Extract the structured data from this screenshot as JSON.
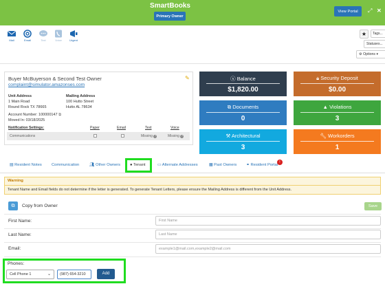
{
  "header": {
    "title": "SmartBooks",
    "primary_owner": "Primary Owner",
    "view_portal": "View Portal",
    "colors": {
      "bg": "#7cc244",
      "button": "#2a74b7"
    }
  },
  "toolbar": {
    "tools": [
      {
        "label": "Mail",
        "icon": "envelope-icon"
      },
      {
        "label": "Email",
        "icon": "at-sign-icon"
      },
      {
        "label": "Text",
        "icon": "chat-bubble-icon"
      },
      {
        "label": "Voice",
        "icon": "phone-icon"
      },
      {
        "label": "Urgent",
        "icon": "megaphone-icon"
      }
    ],
    "tags": "Tags...",
    "statuses": "Statuses...",
    "options": "Options"
  },
  "owner": {
    "name": "Buyer McBuyerson & Second Test Owner",
    "email": "complaint@simulator.amazonses.com",
    "unit_address_label": "Unit Address",
    "unit_address_line1": "1 Main Road",
    "unit_address_line2": "Round Rock TX 78665",
    "mailing_address_label": "Mailing Address",
    "mailing_address_line1": "100 Hutto Street",
    "mailing_address_line2": "Hutto AL 78634",
    "account_number": "Account Number: 100000147",
    "moved_in": "Moved In: 03/18/2025",
    "notification_settings": "Notification Settings:",
    "notif_headers": {
      "paper": "Paper",
      "email": "Email",
      "text": "Text",
      "voice": "Voice"
    },
    "notif_row": {
      "label": "Communications",
      "text": "Missing",
      "voice": "Missing"
    }
  },
  "tiles": [
    {
      "label": "Balance",
      "value": "$1,820.00",
      "color": "#2f3e4e",
      "icon": "dollar-icon"
    },
    {
      "label": "Security Deposit",
      "value": "$0.00",
      "color": "#c46c2c",
      "icon": "lock-icon"
    },
    {
      "label": "Documents",
      "value": "0",
      "color": "#2f7cc0",
      "icon": "copy-icon"
    },
    {
      "label": "Violations",
      "value": "3",
      "color": "#3ea63e",
      "icon": "warning-icon"
    },
    {
      "label": "Architectural",
      "value": "3",
      "color": "#12a9df",
      "icon": "hammer-icon"
    },
    {
      "label": "Workorders",
      "value": "1",
      "color": "#f47a1f",
      "icon": "wrench-icon"
    }
  ],
  "tabs": [
    {
      "label": "Resident Notes"
    },
    {
      "label": "Communication"
    },
    {
      "label": "Other Owners",
      "icon": "users-icon"
    },
    {
      "label": "Tenant",
      "icon": "user-circle-icon"
    },
    {
      "label": "Alternate Addresses",
      "icon": "address-card-icon"
    },
    {
      "label": "Past Owners",
      "icon": "building-icon"
    },
    {
      "label": "Resident Portal",
      "icon": "link-icon"
    }
  ],
  "portal_badge": "!",
  "warning": {
    "title": "Warning",
    "text": "Tenant Name and Email fields do not determine if the letter is generated. To generate Tenant Letters, please ensure the Mailing Address is different from the Unit Address."
  },
  "form": {
    "copy_label": "Copy from Owner",
    "save": "Save",
    "first_name_label": "First Name:",
    "first_name_placeholder": "First Name",
    "last_name_label": "Last Name:",
    "last_name_placeholder": "Last Name",
    "email_label": "Email:",
    "email_placeholder": "example1@mail.com,example2@mail.com",
    "phones_label": "Phones:",
    "phone_type": "Cell Phone 1",
    "phone_value": "(987) 654-3210",
    "add": "Add"
  }
}
